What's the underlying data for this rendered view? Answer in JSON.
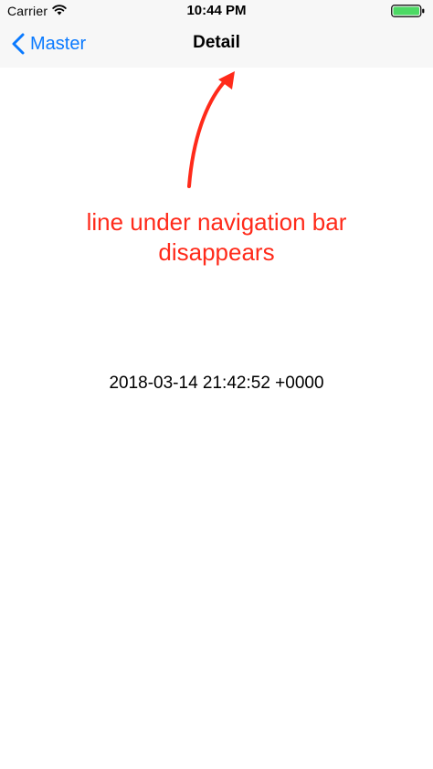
{
  "status_bar": {
    "carrier": "Carrier",
    "time": "10:44 PM",
    "wifi_icon": "wifi-icon",
    "battery_icon": "battery-icon",
    "battery_color": "#4cd964"
  },
  "nav_bar": {
    "back_label": "Master",
    "back_icon": "chevron-left-icon",
    "title": "Detail",
    "background": "#f7f7f7",
    "tint_color": "#0a7aff"
  },
  "annotation": {
    "line1": "line under navigation bar",
    "line2": "disappears",
    "color": "#ff2a1a",
    "arrow_icon": "arrow-up-icon"
  },
  "content": {
    "detail_text": "2018-03-14 21:42:52 +0000"
  }
}
